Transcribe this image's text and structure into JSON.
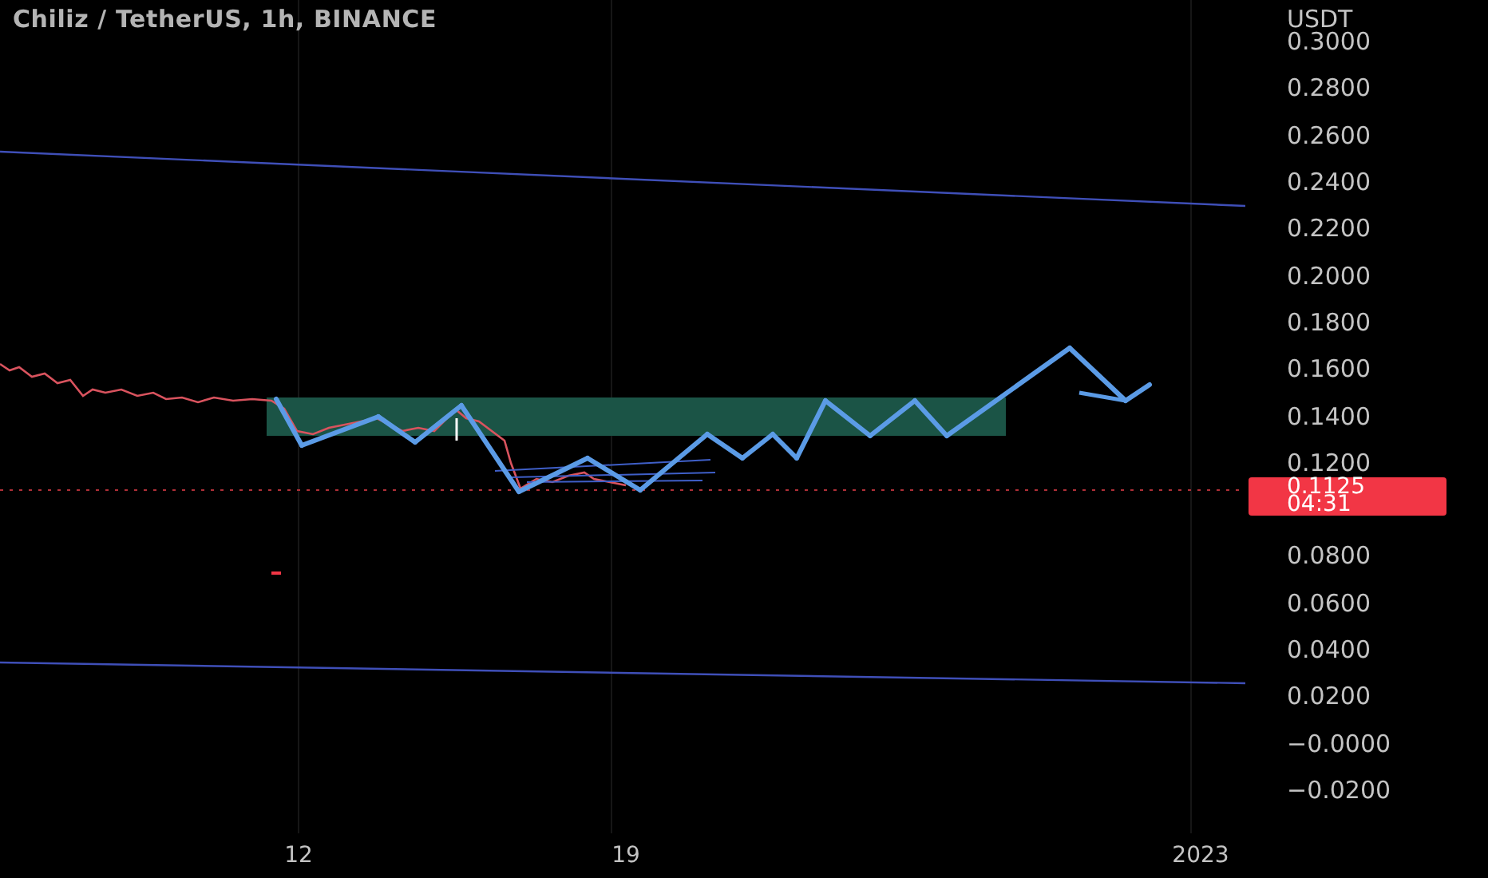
{
  "title": "Chiliz / TetherUS, 1h, BINANCE",
  "price_axis": {
    "currency": "USDT",
    "labels_above": [
      "0.3000",
      "0.2800",
      "0.2600",
      "0.2400",
      "0.2200",
      "0.2000",
      "0.1800",
      "0.1600",
      "0.1400",
      "0.1200"
    ],
    "labels_below": [
      "0.0800",
      "0.0600",
      "0.0400",
      "0.0200",
      "−0.0000",
      "−0.0200"
    ]
  },
  "last_price": {
    "price": "0.1125",
    "countdown": "04:31"
  },
  "time_axis": {
    "labels": [
      "12",
      "19",
      "2023"
    ]
  }
}
